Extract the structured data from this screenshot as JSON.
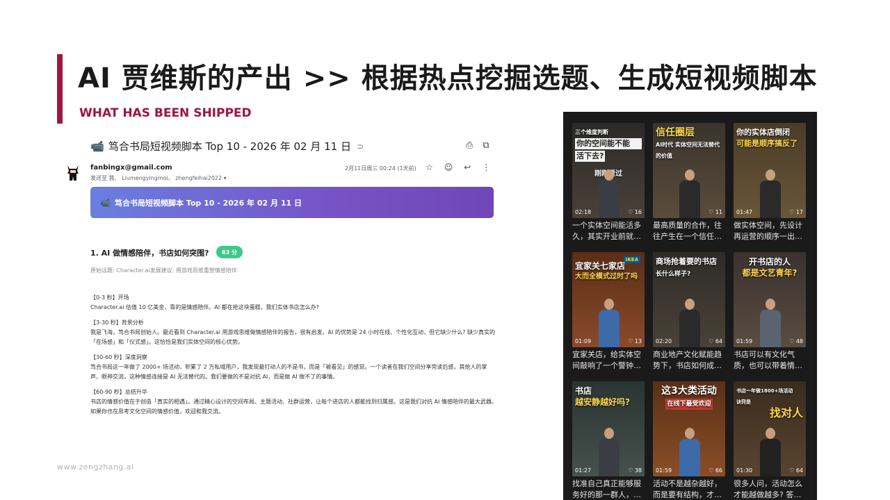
{
  "slide": {
    "title": "AI 贾维斯的产出 >> 根据热点挖掘选题、生成短视频脚本",
    "subtitle": "WHAT HAS BEEN SHIPPED",
    "footer": "www.zengzhang.ai",
    "accent_color": "#a0153e"
  },
  "email": {
    "subject_icon": "video-camera-icon",
    "subject": "笃合书局短视频脚本 Top 10 - 2026 年 02 月 11 日",
    "label_icon": "label-tag-icon",
    "top_actions": [
      "print-icon",
      "open-in-new-window-icon"
    ],
    "sender": "fanbingx@gmail.com",
    "recipients": "发送至 我、 Liumengyingmoi、 zhengfeihai2022 ▾",
    "date": "2月11日周三 00:24 (1天前)",
    "message_actions": [
      "star-icon",
      "emoji-icon",
      "reply-icon",
      "more-icon"
    ],
    "banner_icon": "video-camera-icon",
    "banner_text": "笃合书局短视频脚本 Top 10 - 2026 年 02 月 11 日",
    "banner_gradient": [
      "#6a7fe0",
      "#7046b8"
    ],
    "topic_title": "1. AI 做情感陪伴，书店如何突围?",
    "score_badge": "83 分",
    "score_color": "#3cc98b",
    "source_line": "原始话题: Character.ai发展建议: 用游戏思维重塑情感陪伴",
    "sections": [
      {
        "heading": "【0-3 秒】开场",
        "body": "Character.ai 估值 10 亿美金，靠的是情感陪伴。AI 都在抢这块蛋糕，我们实体书店怎么办?"
      },
      {
        "heading": "【3-30 秒】背景分析",
        "body": "我是飞海，笃合书局创始人。最近看到 Character.ai 用游戏思维做情感陪伴的报告，很有启发。AI 的优势是 24 小时在线、个性化互动，但它缺少什么? 缺少真实的「在场感」和「仪式感」。这恰恰是我们实体空间的核心优势。"
      },
      {
        "heading": "【30-60 秒】深度洞察",
        "body": "笃合书局这一年做了 2000+ 场活动，积累了 2 万私域用户，我发现最打动人的不是书，而是「被看见」的感觉。一个读者在我们空间分享完读后感，其他人的掌声、眼神交流，这种情感连接是 AI 无法替代的。我们要做的不是对抗 AI，而是做 AI 做不了的事情。"
      },
      {
        "heading": "【60-90 秒】总结升华",
        "body": "书店的情感价值在于创造「真实的相遇」。通过精心设计的空间布局、主题活动、社群运营，让每个进店的人都能找到归属感。这是我们对抗 AI 情感陪伴的最大武器。如果你也在思考文化空间的情感价值，欢迎和我交流。"
      }
    ]
  },
  "videos": [
    {
      "overlay_small": "三个维度判断",
      "overlay_main": "你的空间能不能",
      "overlay_main2": "活下去?",
      "mid": "刚刚看过",
      "duration": "02:18",
      "likes": "16",
      "caption": "一个实体空间能活多久，其实开业前就…",
      "bg": "#3a3530"
    },
    {
      "overlay_main": "信任圈层",
      "overlay_sub": "AI时代 实体空间无法替代的价值",
      "duration": "",
      "likes": "11",
      "caption": "最高质量的合作，往往产生在一个信任…",
      "bg": "#4a4034"
    },
    {
      "overlay_main": "你的实体店倒闭",
      "overlay_main2": "可能是顺序搞反了",
      "duration": "01:47",
      "likes": "17",
      "caption": "做实体空间，先设计再运营的顺序一出…",
      "bg": "#5a4a32"
    },
    {
      "overlay_main": "宜家关七家店",
      "overlay_main2": "大而全模式过时了吗",
      "badge": "IKEA",
      "duration": "01:09",
      "likes": "13",
      "caption": "宜家关店，给实体空间敲响了一个警钟…",
      "bg": "#6a3a22"
    },
    {
      "overlay_main": "商场抢着要的书店",
      "overlay_main2": "长什么样子?",
      "duration": "02:20",
      "likes": "64",
      "caption": "商业地产文化赋能趋势下，书店如何成…",
      "bg": "#3f3a34"
    },
    {
      "overlay_main": "开书店的人",
      "overlay_main2": "都是文艺青年?",
      "duration": "01:59",
      "likes": "48",
      "caption": "书店可以有文化气质，也可以带着情…",
      "bg": "#4a3f36"
    },
    {
      "overlay_main": "书店",
      "overlay_main2": "越安静越好吗?",
      "duration": "01:27",
      "likes": "38",
      "caption": "找准自己真正能够服务好的那一群人，…",
      "bg": "#2f3b3a"
    },
    {
      "overlay_main": "这3大类活动",
      "overlay_main2": "在线下最受欢迎",
      "duration": "01:59",
      "likes": "66",
      "caption": "活动不是越杂越好，而是要有结构，才…",
      "bg": "#5a3520"
    },
    {
      "overlay_small": "书店一年做1800+场活动",
      "overlay_small2": "诀窍是",
      "overlay_main": "找对人",
      "duration": "01:30",
      "likes": "64",
      "caption": "很多人问，活动怎么才能越做越多? 答…",
      "bg": "#3a2e22"
    }
  ]
}
